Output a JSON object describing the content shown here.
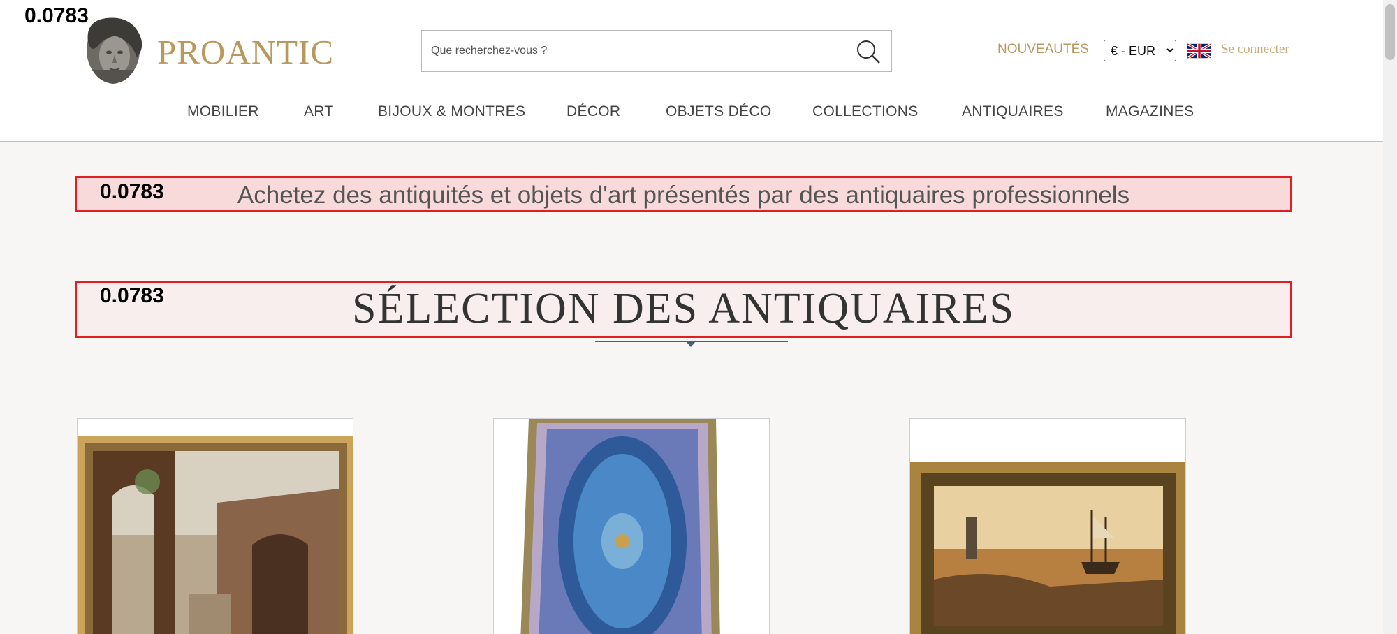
{
  "header": {
    "brand": "PROANTIC",
    "search_placeholder": "Que recherchez-vous ?",
    "nouveautes": "NOUVEAUTÉS",
    "currency": "€ - EUR",
    "login": "Se connecter"
  },
  "nav": {
    "items": [
      "MOBILIER",
      "ART",
      "BIJOUX & MONTRES",
      "DÉCOR",
      "OBJETS DÉCO",
      "COLLECTIONS",
      "ANTIQUAIRES",
      "MAGAZINES"
    ]
  },
  "scores": [
    "0.0783",
    "0.0783",
    "0.0783"
  ],
  "main": {
    "tagline": "Achetez des antiquités et objets d'art présentés par des antiquaires professionnels",
    "section_title": "SÉLECTION DES ANTIQUAIRES"
  },
  "products": [
    {
      "image": "ruins-painting"
    },
    {
      "image": "blue-silk-rug"
    },
    {
      "image": "harbor-sunset-painting"
    }
  ]
}
